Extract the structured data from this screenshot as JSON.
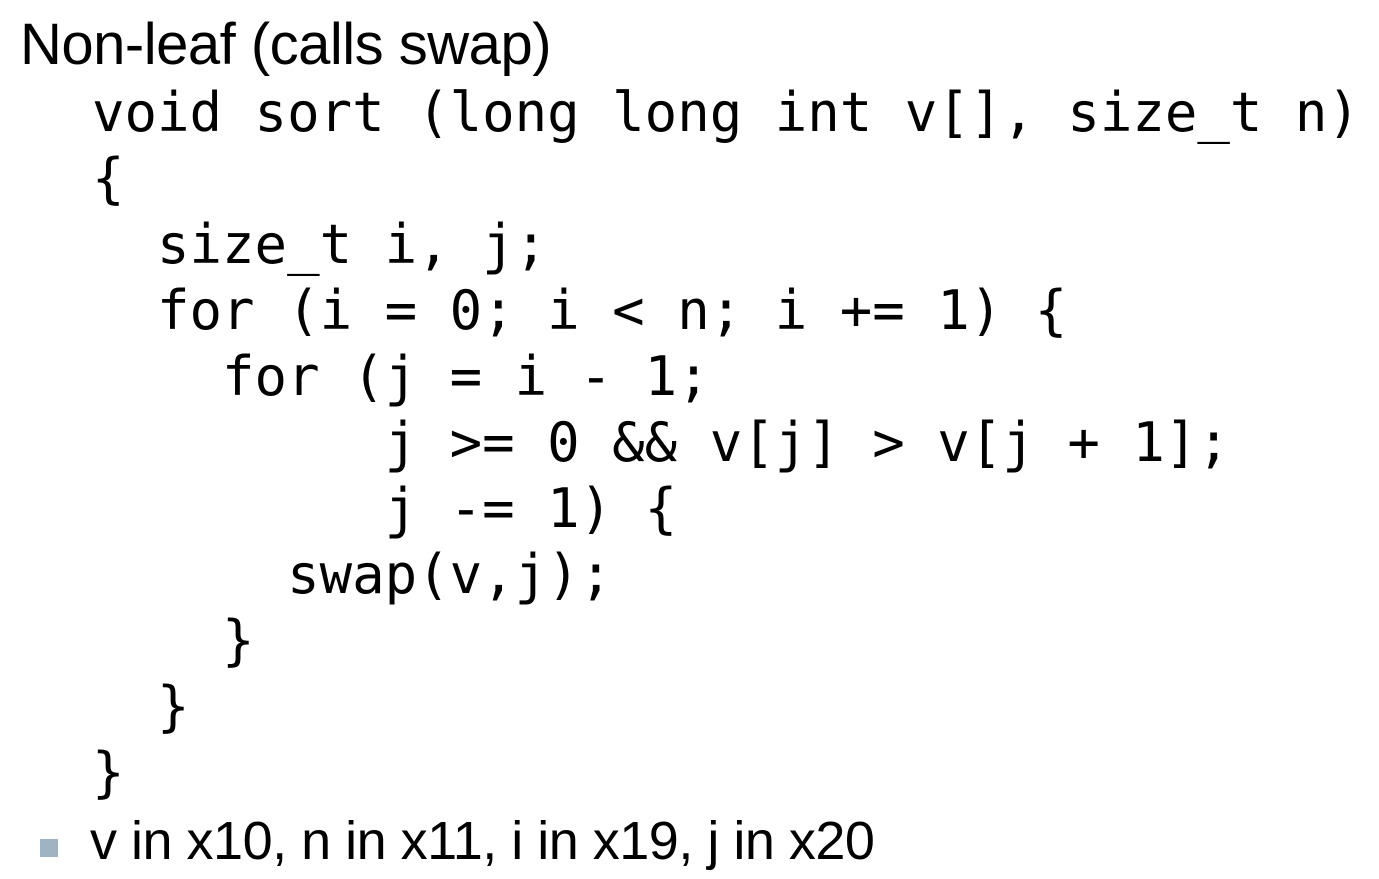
{
  "slide": {
    "title": "Non-leaf (calls swap)",
    "code_lines": [
      "void sort (long long int v[], size_t n)",
      "{",
      "  size_t i, j;",
      "  for (i = 0; i < n; i += 1) {",
      "    for (j = i - 1;",
      "         j >= 0 && v[j] > v[j + 1];",
      "         j -= 1) {",
      "      swap(v,j);",
      "    }",
      "  }",
      "}"
    ],
    "bullet": "v in x10, n in x11, i in x19, j in x20"
  },
  "colors": {
    "text": "#000000",
    "bullet_marker": "#9fb3c2",
    "background": "#ffffff"
  }
}
